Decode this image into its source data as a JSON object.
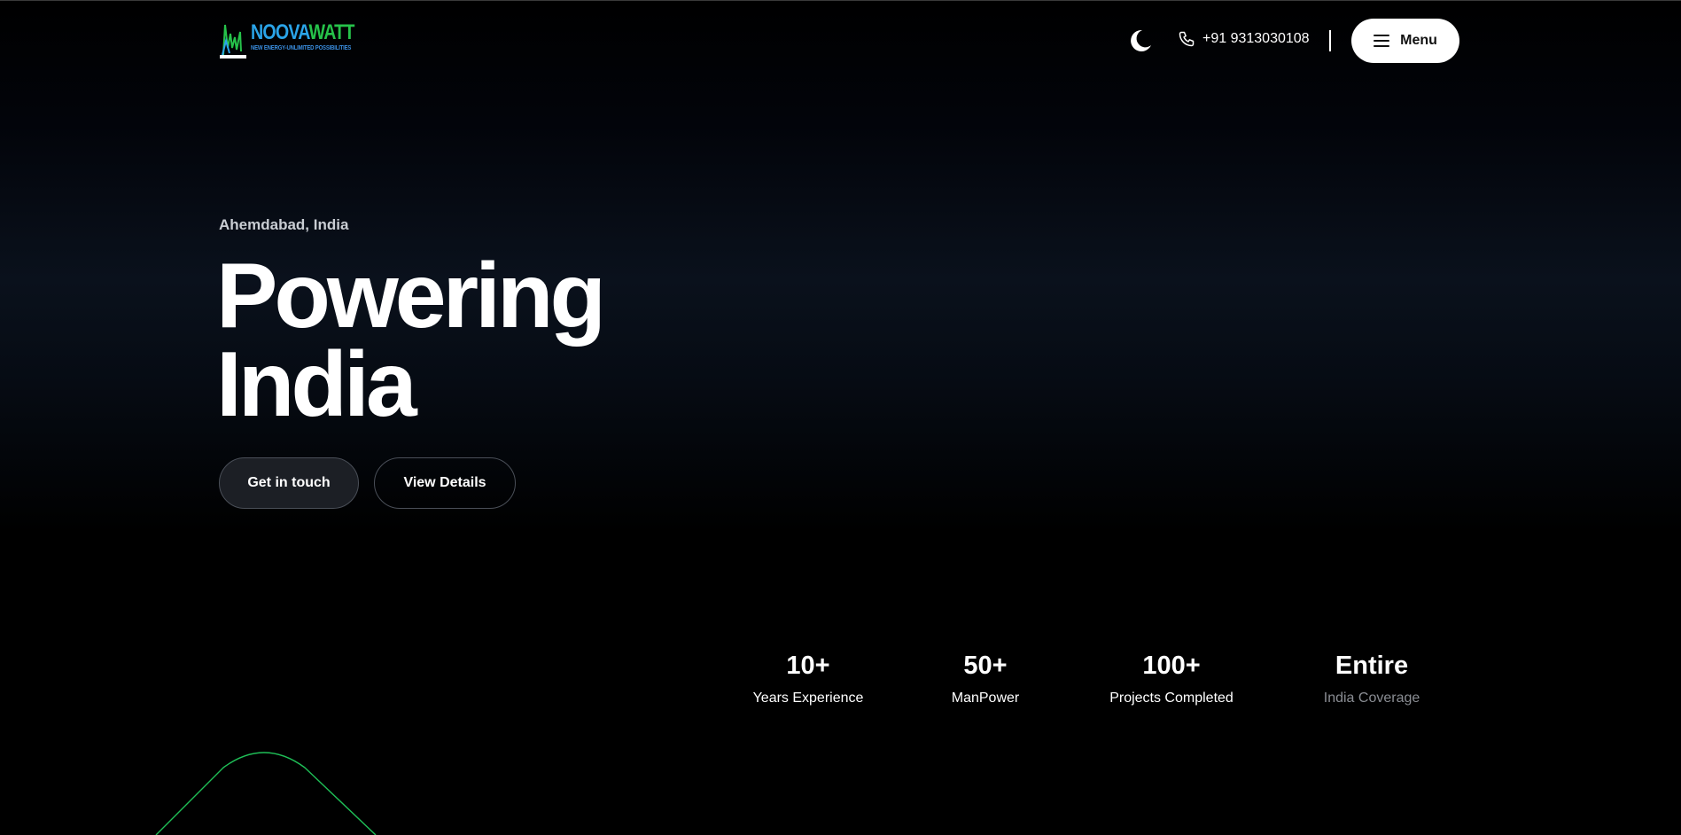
{
  "header": {
    "logo": {
      "word_part1": "NOOVA",
      "word_part2": "WATT",
      "tagline": "NEW ENERGY-UNLIMITED POSSIBILITIES"
    },
    "theme_toggle_icon": "moon-icon",
    "phone": {
      "icon": "phone-icon",
      "number": "+91 9313030108"
    },
    "menu": {
      "icon": "hamburger-icon",
      "label": "Menu"
    }
  },
  "hero": {
    "location": "Ahemdabad, India",
    "headline_line1": "Powering",
    "headline_line2": "India",
    "primary_button": "Get in touch",
    "secondary_button": "View Details"
  },
  "stats": [
    {
      "value": "10+",
      "label": "Years Experience"
    },
    {
      "value": "50+",
      "label": "ManPower"
    },
    {
      "value": "100+",
      "label": "Projects Completed"
    },
    {
      "value": "Entire",
      "label": "India Coverage"
    }
  ],
  "colors": {
    "logo_blue": "#2aa4e8",
    "logo_green": "#26c24a",
    "accent_green": "#1fbf57",
    "background": "#000000"
  }
}
